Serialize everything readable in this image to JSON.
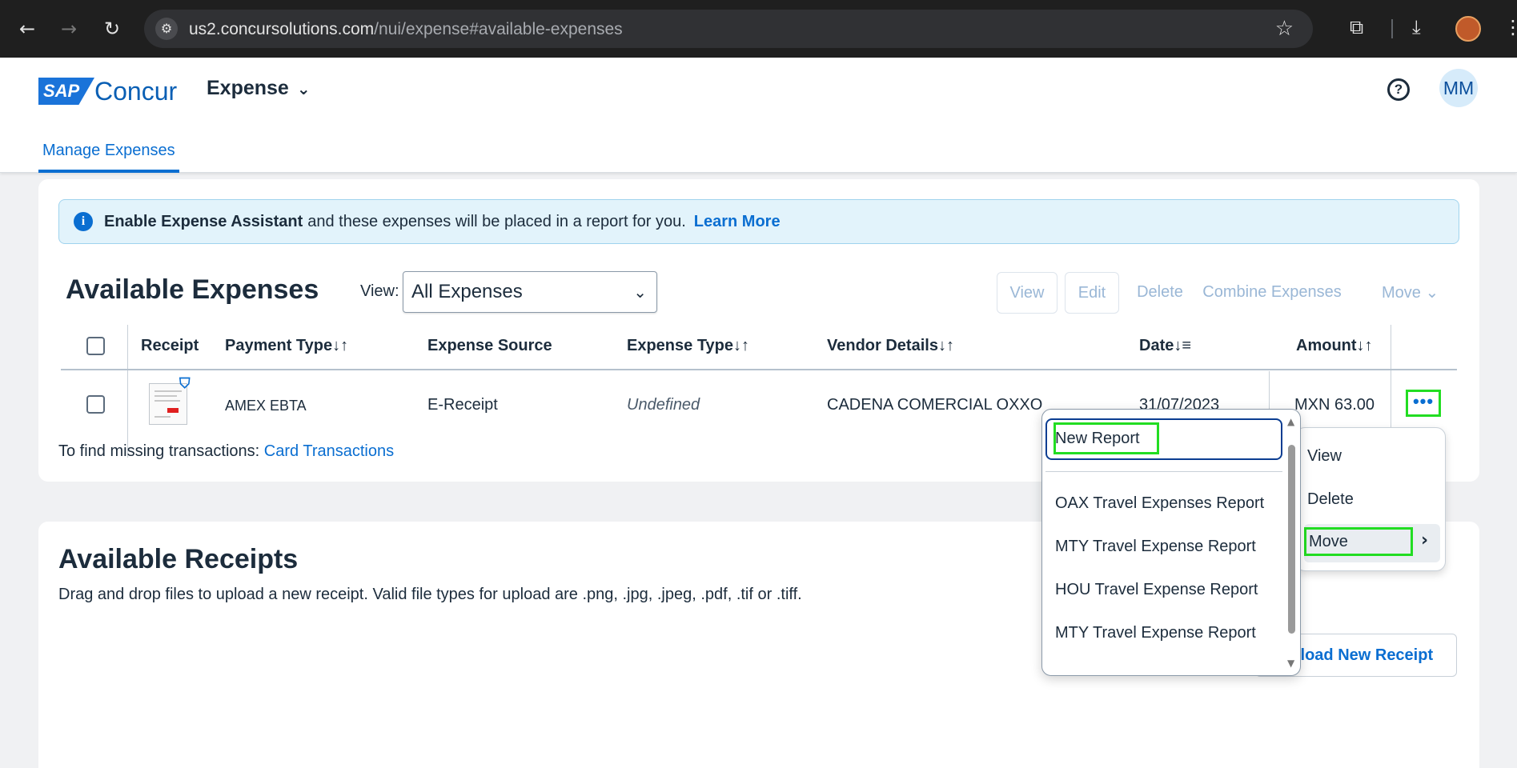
{
  "browser": {
    "url_host": "us2.concursolutions.com",
    "url_path": "/nui/expense#available-expenses",
    "back_icon": "←",
    "forward_icon": "→",
    "reload_icon": "↻"
  },
  "header": {
    "logo_sap": "SAP",
    "logo_concur": "Concur",
    "product": "Expense",
    "help_icon": "?",
    "avatar_initials": "MM",
    "tab_active": "Manage Expenses"
  },
  "banner": {
    "bold_text": "Enable Expense Assistant",
    "text": "and these expenses will be placed in a report for you.",
    "link": "Learn More"
  },
  "expenses": {
    "title": "Available Expenses",
    "view_label": "View:",
    "view_value": "All Expenses",
    "toolbar": {
      "view": "View",
      "edit": "Edit",
      "delete": "Delete",
      "combine": "Combine Expenses",
      "move": "Move"
    },
    "columns": {
      "receipt": "Receipt",
      "payment_type": "Payment Type",
      "expense_source": "Expense Source",
      "expense_type": "Expense Type",
      "vendor": "Vendor Details",
      "date": "Date",
      "amount": "Amount"
    },
    "sort_icon": "↓↑",
    "rows": [
      {
        "payment_type": "AMEX EBTA",
        "expense_source": "E-Receipt",
        "expense_type": "Undefined",
        "vendor": "CADENA COMERCIAL OXXO",
        "date": "31/07/2023",
        "amount": "MXN 63.00"
      }
    ],
    "find_text": "To find missing transactions:",
    "find_link": "Card Transactions"
  },
  "receipts": {
    "title": "Available Receipts",
    "description": "Drag and drop files to upload a new receipt. Valid file types for upload are .png, .jpg, .jpeg, .pdf, .tif or .tiff.",
    "upload_button": "Upload New Receipt"
  },
  "action_menu": {
    "items": [
      "View",
      "Delete",
      "Move"
    ]
  },
  "report_menu": {
    "new_report": "New Report",
    "reports": [
      "OAX Travel Expenses Report",
      "MTY Travel Expense Report",
      "HOU Travel Expense Report",
      "MTY Travel Expense Report"
    ]
  },
  "colors": {
    "accent": "#0a6ed1",
    "highlight": "#22dd22"
  }
}
